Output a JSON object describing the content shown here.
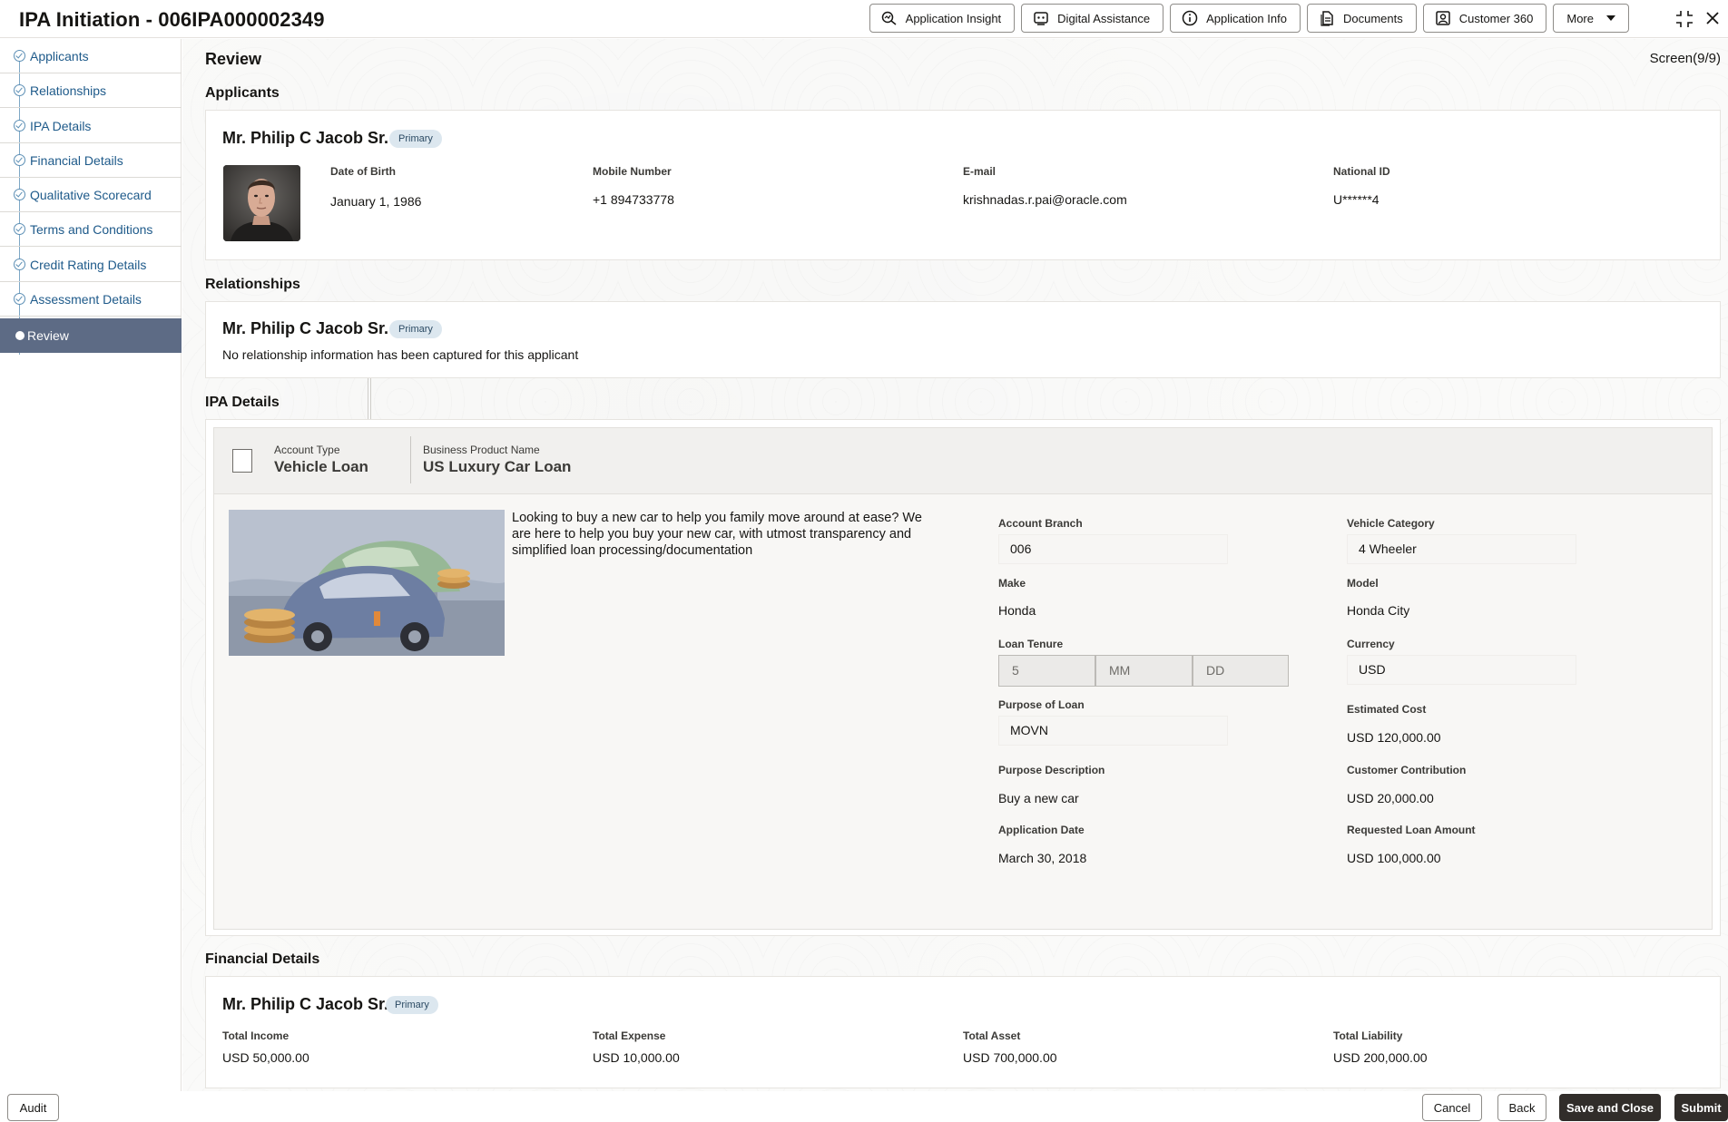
{
  "header": {
    "title": "IPA Initiation - 006IPA000002349",
    "buttons": [
      {
        "label": "Application Insight",
        "icon": "insight-icon"
      },
      {
        "label": "Digital Assistance",
        "icon": "assistant-icon"
      },
      {
        "label": "Application Info",
        "icon": "info-icon"
      },
      {
        "label": "Documents",
        "icon": "documents-icon"
      },
      {
        "label": "Customer 360",
        "icon": "customer-icon"
      }
    ],
    "more_label": "More"
  },
  "sidebar": {
    "items": [
      {
        "label": "Applicants",
        "state": "done"
      },
      {
        "label": "Relationships",
        "state": "done"
      },
      {
        "label": "IPA Details",
        "state": "done"
      },
      {
        "label": "Financial Details",
        "state": "done"
      },
      {
        "label": "Qualitative Scorecard",
        "state": "done"
      },
      {
        "label": "Terms and Conditions",
        "state": "done"
      },
      {
        "label": "Credit Rating Details",
        "state": "done"
      },
      {
        "label": "Assessment Details",
        "state": "done"
      },
      {
        "label": "Review",
        "state": "active"
      }
    ]
  },
  "page": {
    "title": "Review",
    "screen": "Screen(9/9)"
  },
  "applicants": {
    "section_title": "Applicants",
    "name": "Mr. Philip C Jacob Sr.",
    "badge": "Primary",
    "fields": [
      {
        "label": "Date of Birth",
        "value": "January 1, 1986"
      },
      {
        "label": "Mobile Number",
        "value": "+1 894733778"
      },
      {
        "label": "E-mail",
        "value": "krishnadas.r.pai@oracle.com"
      },
      {
        "label": "National ID",
        "value": "U******4"
      }
    ]
  },
  "relationships": {
    "section_title": "Relationships",
    "name": "Mr. Philip C Jacob Sr.",
    "badge": "Primary",
    "message": "No relationship information has been captured for this applicant"
  },
  "ipa": {
    "section_title": "IPA Details",
    "account_type_label": "Account Type",
    "account_type": "Vehicle Loan",
    "product_label": "Business Product Name",
    "product": "US Luxury Car Loan",
    "description": "Looking to buy a new car to help you family move around at ease? We are here to help you buy your new car, with utmost transparency and simplified loan processing/documentation",
    "account_branch": {
      "label": "Account Branch",
      "value": "006"
    },
    "vehicle_category": {
      "label": "Vehicle Category",
      "value": "4 Wheeler"
    },
    "make": {
      "label": "Make",
      "value": "Honda"
    },
    "model": {
      "label": "Model",
      "value": "Honda City"
    },
    "loan_tenure": {
      "label": "Loan Tenure",
      "years": "5",
      "months_placeholder": "MM",
      "days_placeholder": "DD"
    },
    "currency": {
      "label": "Currency",
      "value": "USD"
    },
    "purpose": {
      "label": "Purpose of Loan",
      "value": "MOVN"
    },
    "estimated_cost": {
      "label": "Estimated Cost",
      "value": "USD 120,000.00"
    },
    "purpose_desc": {
      "label": "Purpose Description",
      "value": "Buy a new car"
    },
    "customer_contribution": {
      "label": "Customer Contribution",
      "value": "USD 20,000.00"
    },
    "application_date": {
      "label": "Application Date",
      "value": "March 30, 2018"
    },
    "requested_amount": {
      "label": "Requested Loan Amount",
      "value": "USD 100,000.00"
    }
  },
  "financial": {
    "section_title": "Financial Details",
    "name": "Mr. Philip C Jacob Sr.",
    "badge": "Primary",
    "fields": [
      {
        "label": "Total Income",
        "value": "USD 50,000.00"
      },
      {
        "label": "Total Expense",
        "value": "USD 10,000.00"
      },
      {
        "label": "Total Asset",
        "value": "USD 700,000.00"
      },
      {
        "label": "Total Liability",
        "value": "USD 200,000.00"
      }
    ]
  },
  "footer": {
    "audit": "Audit",
    "cancel": "Cancel",
    "back": "Back",
    "save_close": "Save and Close",
    "submit": "Submit"
  }
}
